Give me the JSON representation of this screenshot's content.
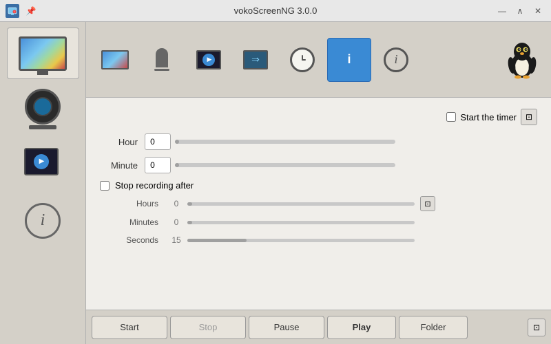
{
  "titlebar": {
    "title": "vokoScreenNG 3.0.0",
    "pin_label": "📌",
    "minimize_label": "—",
    "maximize_label": "∧",
    "close_label": "✕"
  },
  "toolbar": {
    "tabs": [
      {
        "id": "screen",
        "label": "Screen"
      },
      {
        "id": "audio",
        "label": "Audio"
      },
      {
        "id": "record",
        "label": "Record"
      },
      {
        "id": "stream",
        "label": "Stream"
      },
      {
        "id": "timer",
        "label": "Timer"
      },
      {
        "id": "info-bubble",
        "label": "Info Bubble"
      },
      {
        "id": "about",
        "label": "About"
      }
    ],
    "linux_label": "Linux"
  },
  "sidebar": {
    "items": [
      {
        "id": "screen",
        "label": "Screen"
      },
      {
        "id": "webcam",
        "label": "Webcam"
      },
      {
        "id": "player",
        "label": "Player"
      },
      {
        "id": "about",
        "label": "About"
      }
    ]
  },
  "timer": {
    "hour_label": "Hour",
    "hour_value": "0",
    "minute_label": "Minute",
    "minute_value": "0",
    "start_timer_label": "Start the timer",
    "stop_recording_label": "Stop recording after",
    "hours_label": "Hours",
    "hours_value": "0",
    "hours_slider_value": 0,
    "minutes_label": "Minutes",
    "minutes_value": "0",
    "minutes_slider_value": 0,
    "seconds_label": "Seconds",
    "seconds_value": "15",
    "seconds_slider_value": 15
  },
  "bottom": {
    "start_label": "Start",
    "stop_label": "Stop",
    "pause_label": "Pause",
    "play_label": "Play",
    "folder_label": "Folder",
    "expand_label": "⊡"
  }
}
